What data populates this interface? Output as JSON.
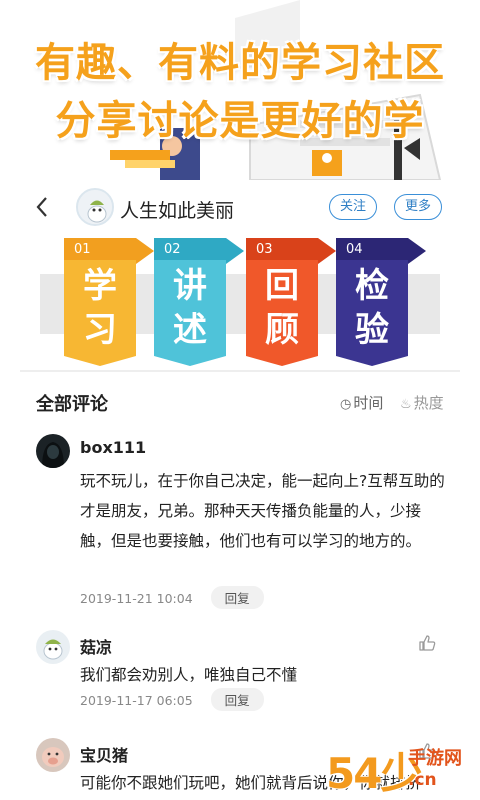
{
  "banner": {
    "line1": "有趣、有料的学习社区",
    "line2": "分享讨论是更好的学"
  },
  "header": {
    "back_icon": "chevron-left-icon",
    "name": "人生如此美丽",
    "follow_label": "关注",
    "more_label": "更多",
    "accent": "#3a8fd8"
  },
  "steps": [
    {
      "num": "01",
      "line1": "学",
      "line2": "习",
      "color": "#f7b733",
      "tab": "#f29f1f"
    },
    {
      "num": "02",
      "line1": "讲",
      "line2": "述",
      "color": "#4fc3d9",
      "tab": "#2fa9c4"
    },
    {
      "num": "03",
      "line1": "回",
      "line2": "顾",
      "color": "#f0582a",
      "tab": "#d9421a"
    },
    {
      "num": "04",
      "line1": "检",
      "line2": "验",
      "color": "#3b3591",
      "tab": "#2c2675"
    }
  ],
  "comments_section": {
    "title": "全部评论",
    "sort_time": "时间",
    "sort_hot": "热度",
    "reply_label": "回复"
  },
  "comments": [
    {
      "name": "box111",
      "text": "玩不玩儿，在于你自己决定，能一起向上?互帮互助的才是朋友，兄弟。那种天天传播负能量的人，少接触，但是也要接触，他们也有可以学习的地方的。",
      "time": "2019-11-21 10:04"
    },
    {
      "name": "菇凉",
      "text": "我们都会劝别人，唯独自己不懂",
      "time": "2019-11-17 06:05"
    },
    {
      "name": "宝贝猪",
      "text": "可能你不跟她们玩吧，她们就背后说你，你就排挤你，跟她们玩吧，又比较浪费时间，你说我",
      "time": ""
    }
  ],
  "watermark": {
    "big": "54少",
    "cn": "手游网",
    "domain": ".cn"
  }
}
